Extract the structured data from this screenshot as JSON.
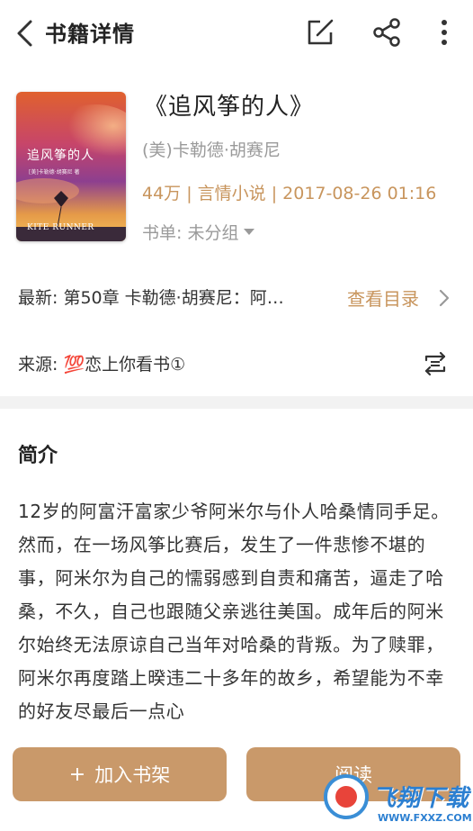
{
  "header": {
    "title": "书籍详情"
  },
  "book": {
    "title": "《追风筝的人》",
    "author": "(美)卡勒德·胡赛尼",
    "meta": "44万 | 言情小说 | 2017-08-26 01:16",
    "book_list": "书单: 未分组",
    "cover": {
      "title": "追风筝的人",
      "subtitle": "[美]卡勒德·胡赛尼 著",
      "english": "KITE RUNNER"
    }
  },
  "latest": {
    "text": "最新: 第50章 卡勒德·胡赛尼：阿…",
    "toc_label": "查看目录"
  },
  "source": {
    "text": "来源: 💯恋上你看书①"
  },
  "intro": {
    "heading": "简介",
    "body": "12岁的阿富汗富家少爷阿米尔与仆人哈桑情同手足。然而，在一场风筝比赛后，发生了一件悲惨不堪的事，阿米尔为自己的懦弱感到自责和痛苦，逼走了哈桑，不久，自己也跟随父亲逃往美国。成年后的阿米尔始终无法原谅自己当年对哈桑的背叛。为了赎罪，阿米尔再度踏上暌违二十多年的故乡，希望能为不幸的好友尽最后一点心"
  },
  "buttons": {
    "add_shelf_plus": "+",
    "add_shelf": "加入书架",
    "read": "阅读"
  },
  "watermark": {
    "text": "飞翔下载",
    "url": "WWW.FXXZ.COM"
  },
  "colors": {
    "accent": "#c8955d",
    "button": "#c9996a",
    "muted": "#9a9a9a",
    "divider": "#f2f2f2"
  }
}
